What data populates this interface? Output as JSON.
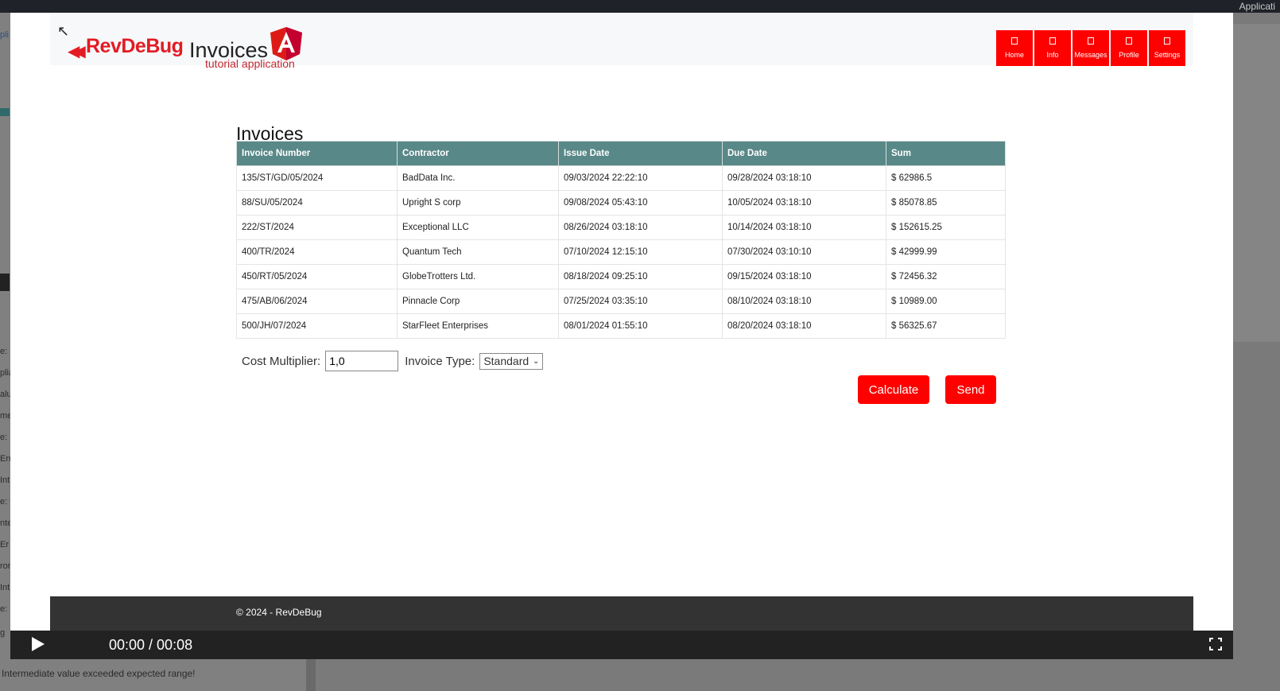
{
  "background": {
    "top_right_label": "Applicati",
    "left_fragments": [
      "pli",
      "e: N",
      "plia",
      "alue",
      "me",
      "e: n",
      "Erro",
      "Int",
      "e: t",
      "nte",
      "Er",
      "ror",
      "Int",
      "e:",
      "g"
    ],
    "bottom_message": "Intermediate value exceeded expected range!"
  },
  "header": {
    "brand": "RevDeBug",
    "app_name": "Invoices",
    "app_subtitle": "tutorial application",
    "nav": [
      {
        "label": "Home"
      },
      {
        "label": "Info"
      },
      {
        "label": "Messages"
      },
      {
        "label": "Profile"
      },
      {
        "label": "Settings"
      }
    ]
  },
  "main": {
    "title": "Invoices",
    "table": {
      "columns": [
        "Invoice Number",
        "Contractor",
        "Issue Date",
        "Due Date",
        "Sum"
      ],
      "rows": [
        [
          "135/ST/GD/05/2024",
          "BadData Inc.",
          "09/03/2024 22:22:10",
          "09/28/2024 03:18:10",
          "$ 62986.5"
        ],
        [
          "88/SU/05/2024",
          "Upright S corp",
          "09/08/2024 05:43:10",
          "10/05/2024 03:18:10",
          "$ 85078.85"
        ],
        [
          "222/ST/2024",
          "Exceptional LLC",
          "08/26/2024 03:18:10",
          "10/14/2024 03:18:10",
          "$ 152615.25"
        ],
        [
          "400/TR/2024",
          "Quantum Tech",
          "07/10/2024 12:15:10",
          "07/30/2024 03:10:10",
          "$ 42999.99"
        ],
        [
          "450/RT/05/2024",
          "GlobeTrotters Ltd.",
          "08/18/2024 09:25:10",
          "09/15/2024 03:18:10",
          "$ 72456.32"
        ],
        [
          "475/AB/06/2024",
          "Pinnacle Corp",
          "07/25/2024 03:35:10",
          "08/10/2024 03:18:10",
          "$ 10989.00"
        ],
        [
          "500/JH/07/2024",
          "StarFleet Enterprises",
          "08/01/2024 01:55:10",
          "08/20/2024 03:18:10",
          "$ 56325.67"
        ]
      ]
    },
    "form": {
      "cost_multiplier_label": "Cost Multiplier:",
      "cost_multiplier_value": "1,0",
      "invoice_type_label": "Invoice Type:",
      "invoice_type_value": "Standard"
    },
    "buttons": {
      "calculate": "Calculate",
      "send": "Send"
    }
  },
  "footer": {
    "text": "© 2024 - RevDeBug"
  },
  "video": {
    "time": "00:00 / 00:08"
  },
  "colors": {
    "accent": "#ff0000",
    "table_header": "#588887",
    "footer": "#333333"
  }
}
